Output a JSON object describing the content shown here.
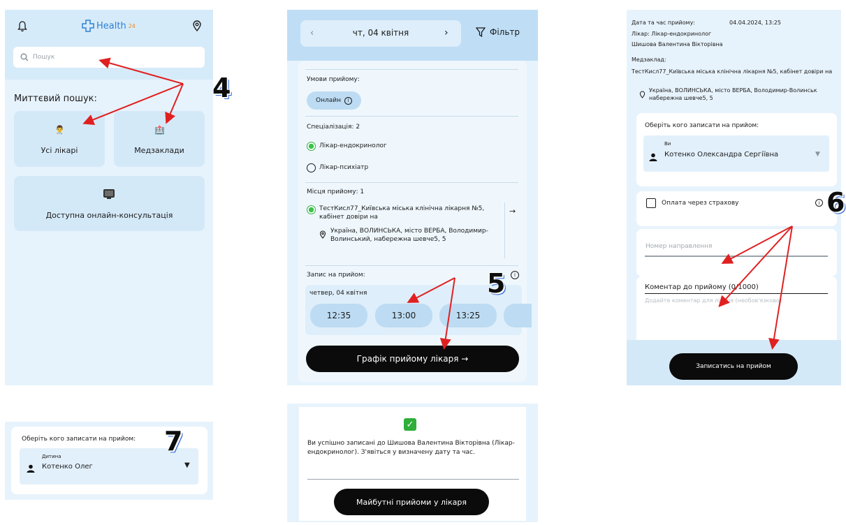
{
  "p1": {
    "brand": "Health",
    "brand_sup": "24",
    "search_placeholder": "Пошук",
    "instant_search": "Миттєвий пошук:",
    "all_doctors": "Усі лікарі",
    "med_facilities": "Медзаклади",
    "online_consult": "Доступна онлайн-консультація",
    "step": "4"
  },
  "p2": {
    "date": "чт, 04 квітня",
    "filter": "Фільтр",
    "conditions_label": "Умови прийому:",
    "online": "Онлайн",
    "spec_label": "Спеціалізація: 2",
    "spec1": "Лікар-ендокринолог",
    "spec2": "Лікар-психіатр",
    "places_label": "Місця прийому: 1",
    "place_name": "ТестКисл77_Київська міська клінічна лікарня №5, кабінет довіри на",
    "place_addr": "Україна, ВОЛИНСЬКА, місто ВЕРБА, Володимир-Волинський, набережна шевче5, 5",
    "booking_label": "Запис на прийом:",
    "day": "четвер, 04 квітня",
    "slots": [
      "12:35",
      "13:00",
      "13:25"
    ],
    "schedule_btn": "Графік прийому лікаря →",
    "step": "5"
  },
  "p3": {
    "datetime_label": "Дата та час прийому:",
    "datetime_value": "04.04.2024, 13:25",
    "doctor_line": "Лікар: Лікар-ендокринолог",
    "doctor_name": "Шишова Валентина Вікторівна",
    "facility_label": "Медзаклад:",
    "facility_name": "ТестКисл77_Київська міська клінічна лікарня №5, кабінет довіри на",
    "facility_addr": "Україна, ВОЛИНСЬКА, місто ВЕРБА, Володимир-Волинськ набережна шевче5, 5",
    "who_label": "Оберіть кого записати на прийом:",
    "who_sub": "Ви",
    "who_name": "Котенко Олександра Сергіївна",
    "insurance": "Оплата через страхову",
    "referral_placeholder": "Номер направлення",
    "comment_label": "Коментар до прийому (0/1000)",
    "comment_placeholder": "Додайте коментар для лікаря (необов'язково)",
    "submit_btn": "Записатись на прийом",
    "step": "6"
  },
  "p4": {
    "who_label": "Оберіть кого записати на прийом:",
    "who_sub": "Дитина",
    "who_name": "Котенко Олег",
    "step": "7"
  },
  "p5": {
    "success_text": "Ви успішно записані до Шишова Валентина Вікторівна (Лікар-ендокринолог). З'явіться у визначену дату та час.",
    "future_btn": "Майбутні прийоми у лікаря"
  },
  "colors": {
    "panel_bg": "#e7f3fc",
    "card": "#d4e9f8",
    "accent": "#2d7fd3",
    "arrow": "#e02020",
    "success": "#2fae3a"
  }
}
